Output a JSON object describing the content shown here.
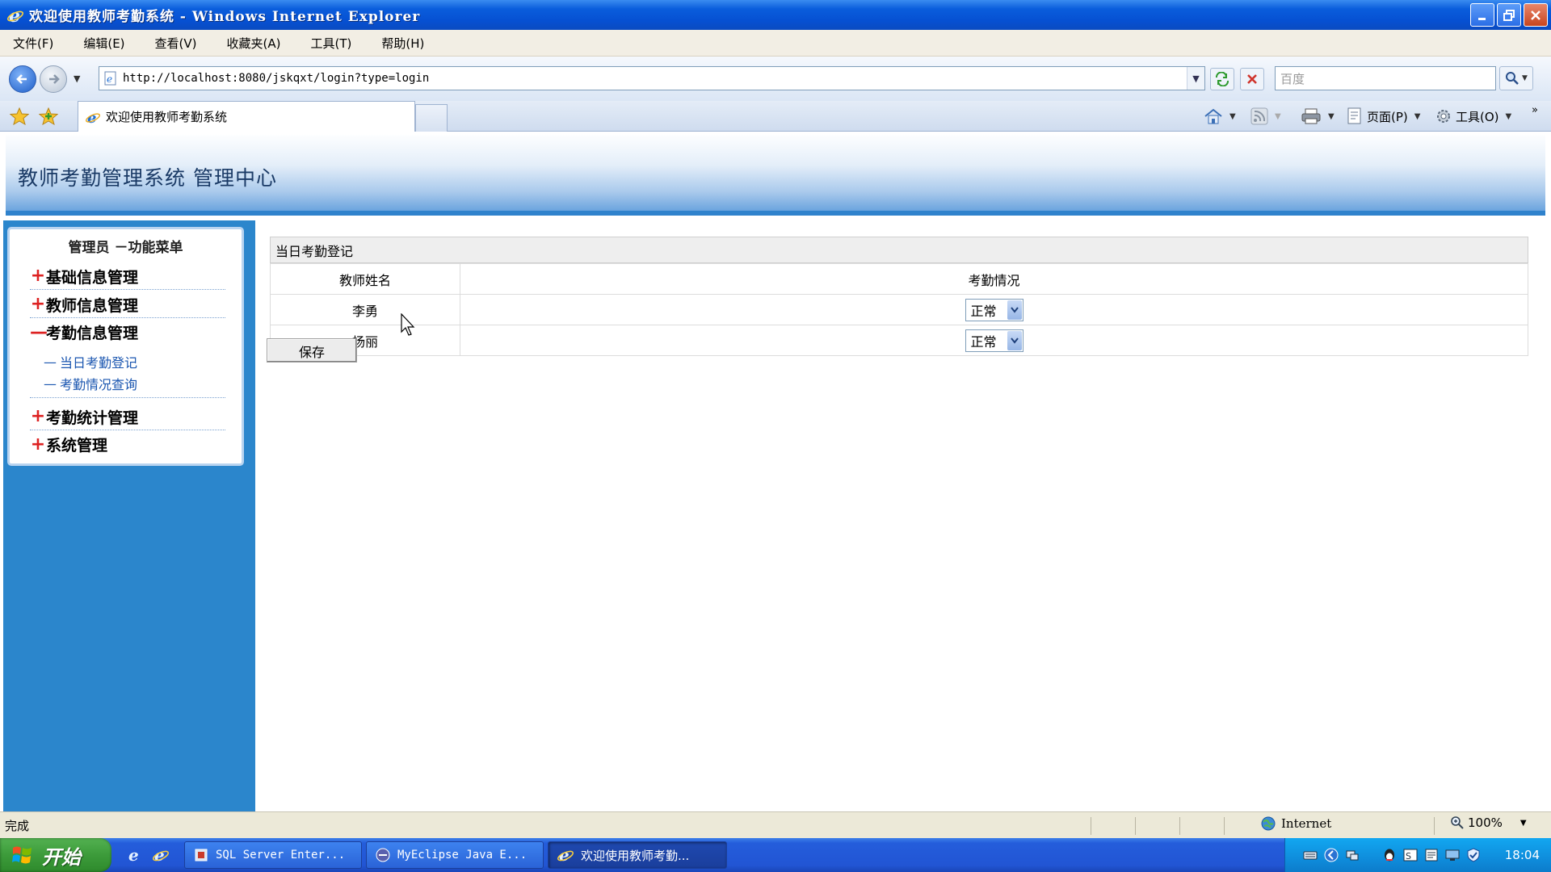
{
  "window": {
    "title": "欢迎使用教师考勤系统 - Windows Internet Explorer"
  },
  "menubar": {
    "items": [
      "文件(F)",
      "编辑(E)",
      "查看(V)",
      "收藏夹(A)",
      "工具(T)",
      "帮助(H)"
    ]
  },
  "address": {
    "url": "http://localhost:8080/jskqxt/login?type=login",
    "search_placeholder": "百度"
  },
  "tab": {
    "label": "欢迎使用教师考勤系统"
  },
  "commandbar": {
    "page_label": "页面(P)",
    "tools_label": "工具(O)"
  },
  "app": {
    "title": "教师考勤管理系统 管理中心"
  },
  "sidebar": {
    "panel_title": "管理员 －功能菜单",
    "groups": [
      {
        "sign": "+",
        "label": "基础信息管理"
      },
      {
        "sign": "+",
        "label": "教师信息管理"
      },
      {
        "sign": "—",
        "label": "考勤信息管理"
      },
      {
        "sign": "+",
        "label": "考勤统计管理"
      },
      {
        "sign": "+",
        "label": "系统管理"
      }
    ],
    "sub_items": [
      {
        "dash": "—",
        "label": "当日考勤登记"
      },
      {
        "dash": "—",
        "label": "考勤情况查询"
      }
    ]
  },
  "attendance": {
    "panel_title": "当日考勤登记",
    "columns": [
      "教师姓名",
      "考勤情况"
    ],
    "rows": [
      {
        "name": "李勇",
        "status": "正常"
      },
      {
        "name": "杨丽",
        "status": "正常"
      }
    ],
    "save_label": "保存"
  },
  "statusbar": {
    "text": "完成",
    "zone": "Internet",
    "zoom": "100%"
  },
  "taskbar": {
    "start_label": "开始",
    "tasks": [
      "SQL Server Enter...",
      "MyEclipse Java E...",
      "欢迎使用教师考勤..."
    ],
    "clock": "18:04"
  },
  "colors": {
    "sidebar_bg": "#2b86cc",
    "header_border": "#2f82cc",
    "menu_sign": "#dd2222",
    "sub_link": "#1a56b0"
  }
}
